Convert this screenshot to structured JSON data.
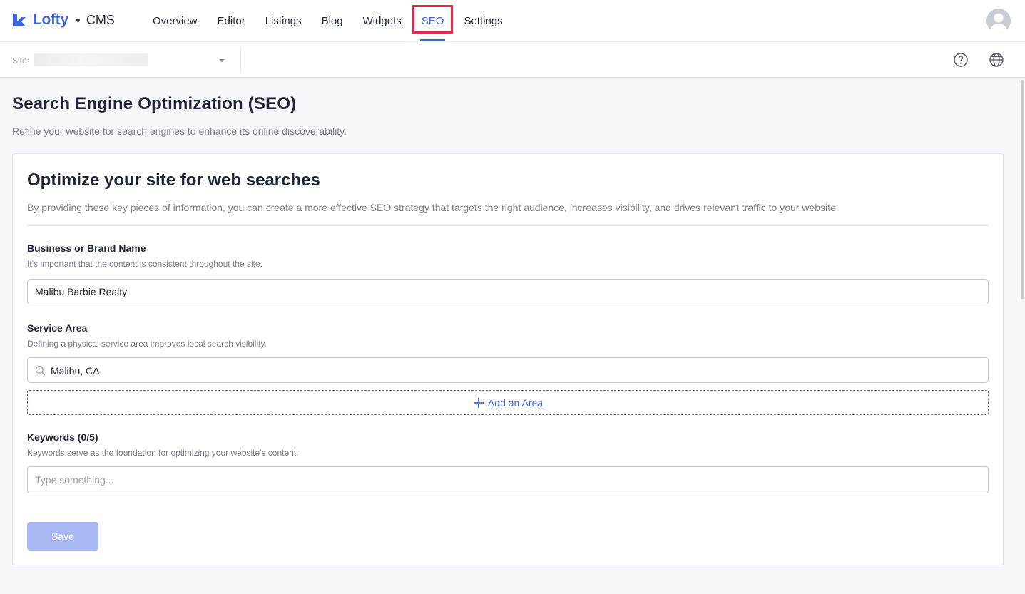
{
  "app": {
    "brand": "Lofty",
    "product": "CMS"
  },
  "nav": {
    "items": [
      {
        "label": "Overview"
      },
      {
        "label": "Editor"
      },
      {
        "label": "Listings"
      },
      {
        "label": "Blog"
      },
      {
        "label": "Widgets"
      },
      {
        "label": "SEO"
      },
      {
        "label": "Settings"
      }
    ],
    "active": "SEO"
  },
  "subbar": {
    "site_label": "Site:",
    "help_icon": "help-circle-icon",
    "globe_icon": "globe-icon"
  },
  "page": {
    "title": "Search Engine Optimization (SEO)",
    "subtitle": "Refine your website for search engines to enhance its online discoverability."
  },
  "card": {
    "title": "Optimize your site for web searches",
    "description": "By providing these key pieces of information, you can create a more effective SEO strategy that targets the right audience, increases visibility, and drives relevant traffic to your website."
  },
  "fields": {
    "business": {
      "label": "Business or Brand Name",
      "help": "It’s important that the content is consistent throughout the site.",
      "value": "Malibu Barbie Realty"
    },
    "service_area": {
      "label": "Service Area",
      "help": "Defining a physical service area improves local search visibility.",
      "value": "Malibu, CA",
      "add_label": "Add an Area"
    },
    "keywords": {
      "label": "Keywords (0/5)",
      "help": "Keywords serve as the foundation for optimizing your website's content.",
      "placeholder": "Type something..."
    }
  },
  "actions": {
    "save_label": "Save"
  },
  "colors": {
    "accent": "#3d64e0",
    "highlight": "#e5284e",
    "save_disabled": "#aab8f3"
  }
}
